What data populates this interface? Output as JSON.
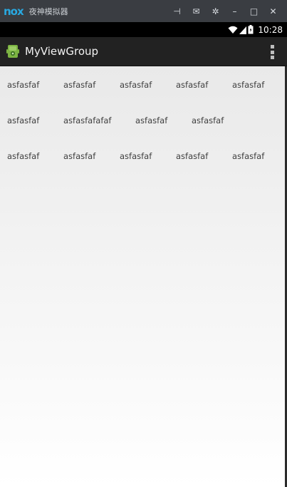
{
  "emulator": {
    "logo_text": "nox",
    "title": "夜神模拟器",
    "controls": [
      {
        "name": "pin-icon",
        "glyph": "⊣"
      },
      {
        "name": "mail-icon",
        "glyph": "✉"
      },
      {
        "name": "settings-icon",
        "glyph": "✲"
      },
      {
        "name": "minimize-icon",
        "glyph": "–"
      },
      {
        "name": "maximize-icon",
        "glyph": "□"
      },
      {
        "name": "close-icon",
        "glyph": "✕"
      }
    ]
  },
  "status_bar": {
    "time": "10:28"
  },
  "action_bar": {
    "title": "MyViewGroup",
    "overflow_icon": "overflow-menu-icon"
  },
  "content": {
    "rows": [
      [
        "asfasfaf",
        "asfasfaf",
        "asfasfaf",
        "asfasfaf",
        "asfasfaf"
      ],
      [
        "asfasfaf",
        "asfasfafafaf",
        "asfasfaf",
        "asfasfaf"
      ],
      [
        "asfasfaf",
        "asfasfaf",
        "asfasfaf",
        "asfasfaf",
        "asfasfaf"
      ]
    ]
  },
  "colors": {
    "emulator_bar": "#3a3d42",
    "status_bar": "#000000",
    "action_bar": "#222222",
    "content_bg_top": "#e9e9e9",
    "content_bg_bottom": "#ffffff"
  }
}
